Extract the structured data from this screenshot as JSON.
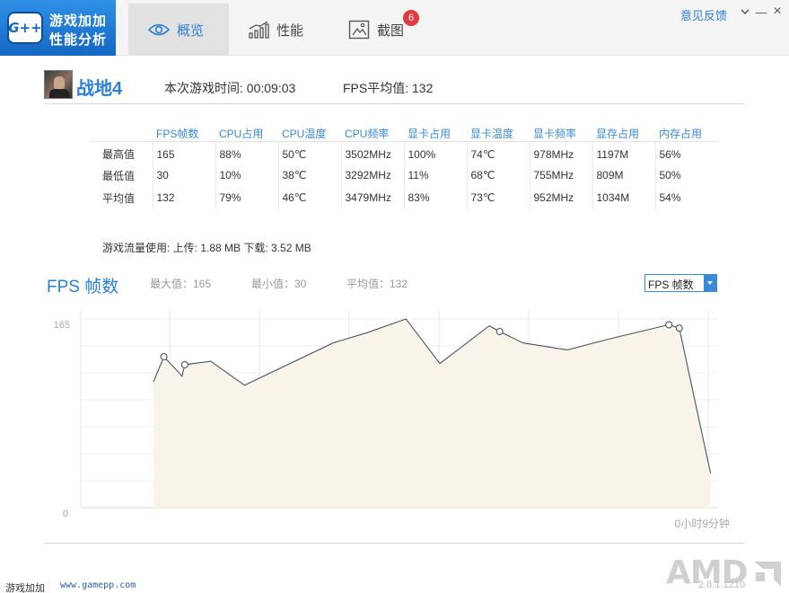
{
  "app": {
    "logo_mark": "G++",
    "name_line1": "游戏加加",
    "name_line2": "性能分析",
    "feedback": "意见反馈",
    "menu_icon": "chevron-down-icon",
    "minimize_glyph": "—",
    "close_glyph": "×"
  },
  "tabs": [
    {
      "label": "概览",
      "icon": "eye-icon",
      "active": true
    },
    {
      "label": "性能",
      "icon": "bar-chart-icon",
      "active": false
    },
    {
      "label": "截图",
      "icon": "image-icon",
      "active": false,
      "badge": "6"
    }
  ],
  "game": {
    "name": "战地4",
    "session_time": "本次游戏时间: 00:09:03",
    "fps_avg": "FPS平均值: 132"
  },
  "stats": {
    "columns": [
      "FPS帧数",
      "CPU占用",
      "CPU温度",
      "CPU频率",
      "显卡占用",
      "显卡温度",
      "显卡频率",
      "显存占用",
      "内存占用"
    ],
    "rows": [
      {
        "label": "最高值",
        "values": [
          "165",
          "88%",
          "50℃",
          "3502MHz",
          "100%",
          "74℃",
          "978MHz",
          "1197M",
          "56%"
        ]
      },
      {
        "label": "最低值",
        "values": [
          "30",
          "10%",
          "38℃",
          "3292MHz",
          "11%",
          "68℃",
          "755MHz",
          "809M",
          "50%"
        ]
      },
      {
        "label": "平均值",
        "values": [
          "132",
          "79%",
          "46℃",
          "3479MHz",
          "83%",
          "73℃",
          "952MHz",
          "1034M",
          "54%"
        ]
      }
    ]
  },
  "traffic": "游戏流量使用: 上传: 1.88 MB   下载: 3.52 MB",
  "chart_header": {
    "title": "FPS 帧数",
    "max": "最大值：165",
    "min": "最小值：30",
    "avg": "平均值：132",
    "select_value": "FPS 帧数"
  },
  "chart_data": {
    "type": "area",
    "y_tick_labels": [
      "165",
      "0"
    ],
    "ylim": [
      0,
      165
    ],
    "x_end_label": "0小时9分钟",
    "grid": true,
    "fill_color": "#f9f4e9",
    "line_color": "#4a5560",
    "series": [
      {
        "points": [
          {
            "x": 0.0,
            "y": 110,
            "marker": false
          },
          {
            "x": 0.4,
            "y": 132,
            "marker": true
          },
          {
            "x": 1.1,
            "y": 115,
            "marker": false
          },
          {
            "x": 1.2,
            "y": 125,
            "marker": true
          },
          {
            "x": 2.2,
            "y": 128,
            "marker": false
          },
          {
            "x": 3.5,
            "y": 107,
            "marker": false
          },
          {
            "x": 6.9,
            "y": 144,
            "marker": false
          },
          {
            "x": 8.2,
            "y": 153,
            "marker": false
          },
          {
            "x": 9.7,
            "y": 165,
            "marker": false
          },
          {
            "x": 11.0,
            "y": 126,
            "marker": false
          },
          {
            "x": 12.9,
            "y": 159,
            "marker": false
          },
          {
            "x": 13.3,
            "y": 154,
            "marker": true
          },
          {
            "x": 14.2,
            "y": 144,
            "marker": false
          },
          {
            "x": 15.9,
            "y": 138,
            "marker": false
          },
          {
            "x": 17.6,
            "y": 148,
            "marker": false
          },
          {
            "x": 19.8,
            "y": 160,
            "marker": true
          },
          {
            "x": 20.2,
            "y": 157,
            "marker": true
          },
          {
            "x": 21.4,
            "y": 30,
            "marker": false
          }
        ]
      }
    ]
  },
  "footer": {
    "brand": "游戏加加",
    "site": "www.gamepp.com",
    "amd_logo": "AMD",
    "version": "2.8.1.1210"
  }
}
